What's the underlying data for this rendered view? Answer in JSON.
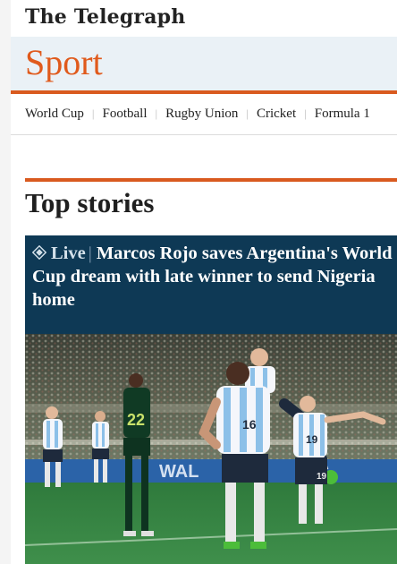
{
  "masthead": {
    "logo_text": "The Telegraph"
  },
  "section": {
    "title": "Sport"
  },
  "subnav": {
    "items": [
      {
        "label": "World Cup"
      },
      {
        "label": "Football"
      },
      {
        "label": "Rugby Union"
      },
      {
        "label": "Cricket"
      },
      {
        "label": "Formula 1"
      }
    ]
  },
  "top_stories": {
    "heading": "Top stories",
    "lead": {
      "live_label": "Live",
      "separator": "|",
      "headline": "Marcos Rojo saves Argentina's World Cup dream with late winner to send Nigeria home",
      "photo_icon": "live-diamond-icon",
      "players": [
        {
          "team": "nigeria",
          "number": "22"
        },
        {
          "team": "argentina",
          "number": "16"
        },
        {
          "team": "argentina",
          "number": "19"
        }
      ]
    }
  },
  "colors": {
    "accent": "#d95a1f",
    "section_band": "#eaf1f6",
    "card_bg": "#0e3955",
    "text": "#222222"
  }
}
